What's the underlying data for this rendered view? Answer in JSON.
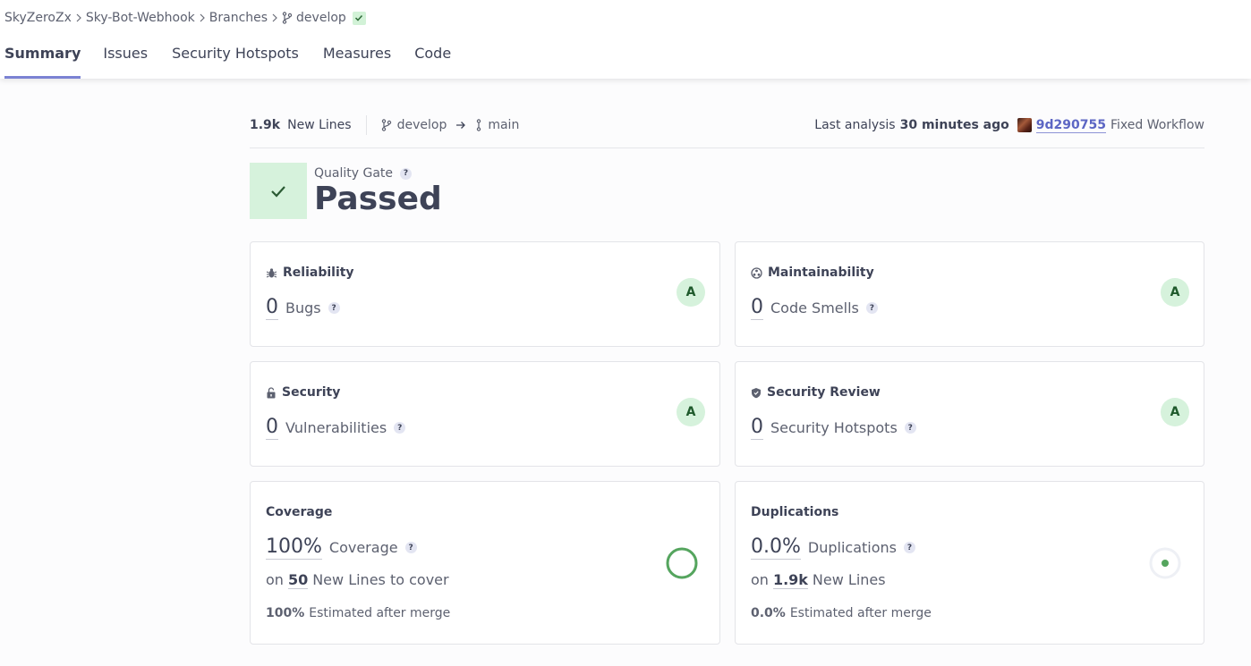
{
  "breadcrumb": {
    "org": "SkyZeroZx",
    "project": "Sky-Bot-Webhook",
    "branches": "Branches",
    "branch": "develop"
  },
  "tabs": [
    {
      "label": "Summary",
      "active": true
    },
    {
      "label": "Issues",
      "active": false
    },
    {
      "label": "Security Hotspots",
      "active": false
    },
    {
      "label": "Measures",
      "active": false
    },
    {
      "label": "Code",
      "active": false
    }
  ],
  "meta": {
    "new_lines_count": "1.9k",
    "new_lines_label": "New Lines",
    "source_branch": "develop",
    "target_branch": "main",
    "last_analysis_label": "Last analysis",
    "last_analysis_time": "30 minutes ago",
    "commit_hash": "9d290755",
    "commit_message": "Fixed Workflow"
  },
  "quality_gate": {
    "label": "Quality Gate",
    "status": "Passed"
  },
  "cards": {
    "reliability": {
      "title": "Reliability",
      "value": "0",
      "label": "Bugs",
      "rating": "A"
    },
    "maintainability": {
      "title": "Maintainability",
      "value": "0",
      "label": "Code Smells",
      "rating": "A"
    },
    "security": {
      "title": "Security",
      "value": "0",
      "label": "Vulnerabilities",
      "rating": "A"
    },
    "security_review": {
      "title": "Security Review",
      "value": "0",
      "label": "Security Hotspots",
      "rating": "A"
    },
    "coverage": {
      "title": "Coverage",
      "value": "100%",
      "label": "Coverage",
      "on_prefix": "on",
      "on_count": "50",
      "on_suffix": "New Lines to cover",
      "estimate_value": "100%",
      "estimate_label": "Estimated after merge",
      "percent": 100
    },
    "duplications": {
      "title": "Duplications",
      "value": "0.0%",
      "label": "Duplications",
      "on_prefix": "on",
      "on_count": "1.9k",
      "on_suffix": "New Lines",
      "estimate_value": "0.0%",
      "estimate_label": "Estimated after merge",
      "percent": 0
    }
  },
  "colors": {
    "accent": "#7b82d3",
    "passed_bg": "#d6f2dc",
    "coverage_green": "#55a55e",
    "link": "#5c66c4"
  },
  "icons": {
    "branch": "git-branch-icon",
    "check": "check-icon",
    "bug": "bug-icon",
    "maintainability": "maintainability-icon",
    "lock": "lock-icon",
    "shield": "shield-icon",
    "arrow": "arrow-right-icon",
    "help": "help-icon"
  }
}
